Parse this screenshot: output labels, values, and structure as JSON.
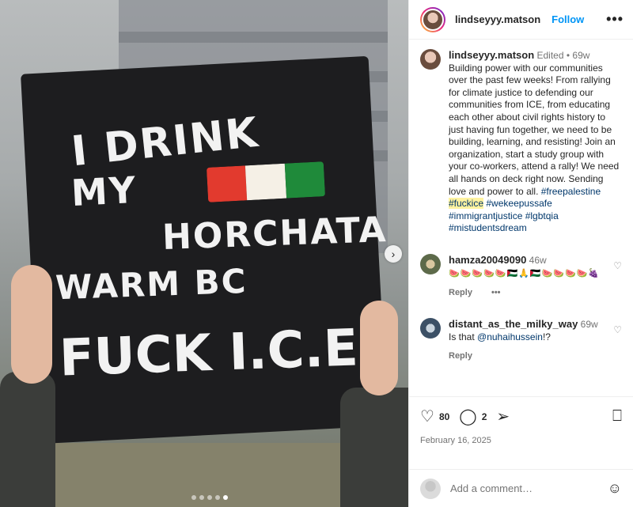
{
  "photo": {
    "sign_lines": [
      "I DRINK",
      "MY",
      "HORCHATA",
      "WARM BC",
      "FUCK I.C.E"
    ],
    "flag_colors": [
      "#e23a2e",
      "#f5f0e6",
      "#1f8a3a"
    ],
    "nav_next": "›",
    "dot_count": 5,
    "active_dot": 4
  },
  "header": {
    "username": "lindseyyy.matson",
    "follow_label": "Follow",
    "more_label": "•••"
  },
  "caption": {
    "username": "lindseyyy.matson",
    "edited": "Edited",
    "sep": "•",
    "age": "69w",
    "text": "Building power with our communities over the past few weeks! From rallying for climate justice to defending our communities from ICE, from educating each other about civil rights history to just having fun together, we need to be building, learning, and resisting! Join an organization, start a study group with your co-workers, attend a rally! We need all hands on deck right now. Sending love and power to all.",
    "tags": [
      "#freepalestine",
      "#fuckice",
      "#wekeepussafe",
      "#immigrantjustice",
      "#lgbtqia",
      "#mistudentsdream"
    ]
  },
  "comments": [
    {
      "username": "hamza20049090",
      "age": "46w",
      "text": "🍉🍉🍉🍉🍉🇵🇸🙏🇵🇸🍉🍉🍉🍉🍇",
      "reply": "Reply",
      "more": "•••"
    },
    {
      "username": "distant_as_the_milky_way",
      "age": "69w",
      "text_prefix": "Is that ",
      "mention": "@nuhaihussein",
      "text_suffix": "!?",
      "reply": "Reply"
    }
  ],
  "actions": {
    "like_icon": "heart-icon",
    "likes": "80",
    "comment_icon": "comment-icon",
    "comments_count": "2",
    "share_icon": "share-icon",
    "save_icon": "bookmark-icon",
    "date": "February 16, 2025"
  },
  "add_comment": {
    "placeholder": "Add a comment…",
    "emoji_icon": "smiley-icon"
  }
}
